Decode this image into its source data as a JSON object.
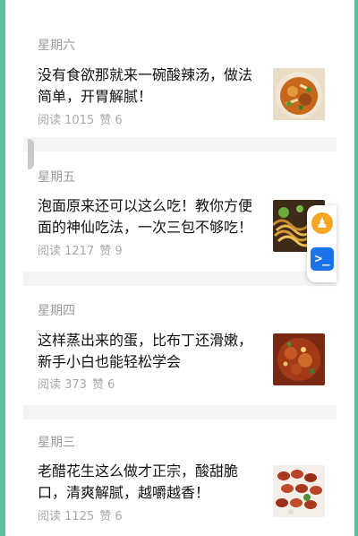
{
  "articles": [
    {
      "day": "星期六",
      "title": "没有食欲那就来一碗酸辣汤，做法简单，开胃解腻！",
      "reads": "阅读 1015",
      "likes": "赞 6",
      "image": "hot-sour-soup-photo"
    },
    {
      "day": "星期五",
      "title": "泡面原来还可以这么吃！教你方便面的神仙吃法，一次三包不够吃！",
      "reads": "阅读 1217",
      "likes": "赞 9",
      "image": "instant-noodles-photo"
    },
    {
      "day": "星期四",
      "title": "这样蒸出来的蛋，比布丁还滑嫩，新手小白也能轻松学会",
      "reads": "阅读 373",
      "likes": "赞 6",
      "image": "steamed-egg-photo"
    },
    {
      "day": "星期三",
      "title": "老醋花生这么做才正宗，酸甜脆口，清爽解腻，越嚼越香！",
      "reads": "阅读 1125",
      "likes": "赞 6",
      "image": "vinegar-peanuts-photo"
    }
  ],
  "floating_toolbar": {
    "accessibility_icon": "accessibility-icon",
    "terminal_icon": "terminal-icon"
  },
  "colors": {
    "edge": "#5fbf9f",
    "separator": "#f4f4f4",
    "muted_text": "#9b9b9b",
    "title_text": "#111111"
  }
}
